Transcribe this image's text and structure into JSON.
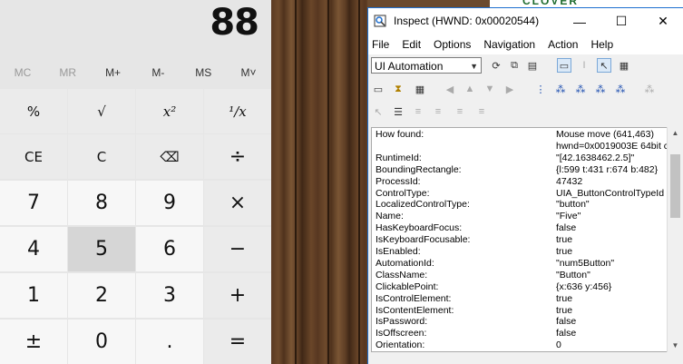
{
  "calculator": {
    "display": "88",
    "memory": [
      "MC",
      "MR",
      "M+",
      "M-",
      "MS",
      "M˅"
    ],
    "keys": [
      [
        "%",
        "√",
        "x²",
        "¹/x"
      ],
      [
        "CE",
        "C",
        "⌫",
        "÷"
      ],
      [
        "7",
        "8",
        "9",
        "×"
      ],
      [
        "4",
        "5",
        "6",
        "−"
      ],
      [
        "1",
        "2",
        "3",
        "+"
      ],
      [
        "±",
        "0",
        ".",
        "="
      ]
    ]
  },
  "background": {
    "banner_text": "CLOVER"
  },
  "inspect": {
    "title": "Inspect  (HWND: 0x00020544)",
    "window_buttons": {
      "minimize": "—",
      "maximize": "☐",
      "close": "✕"
    },
    "menu": [
      "File",
      "Edit",
      "Options",
      "Navigation",
      "Action",
      "Help"
    ],
    "mode": "UI Automation",
    "properties": [
      {
        "name": "How found:",
        "value": "Mouse move (641,463)"
      },
      {
        "name": "",
        "value": "hwnd=0x0019003E 64bit c"
      },
      {
        "name": "RuntimeId:",
        "value": "\"[42.1638462.2.5]\""
      },
      {
        "name": "BoundingRectangle:",
        "value": "{l:599 t:431 r:674 b:482}"
      },
      {
        "name": "ProcessId:",
        "value": "47432"
      },
      {
        "name": "ControlType:",
        "value": "UIA_ButtonControlTypeId"
      },
      {
        "name": "LocalizedControlType:",
        "value": "\"button\""
      },
      {
        "name": "Name:",
        "value": "\"Five\""
      },
      {
        "name": "HasKeyboardFocus:",
        "value": "false"
      },
      {
        "name": "IsKeyboardFocusable:",
        "value": "true"
      },
      {
        "name": "IsEnabled:",
        "value": "true"
      },
      {
        "name": "AutomationId:",
        "value": "\"num5Button\""
      },
      {
        "name": "ClassName:",
        "value": "\"Button\""
      },
      {
        "name": "ClickablePoint:",
        "value": "{x:636 y:456}"
      },
      {
        "name": "IsControlElement:",
        "value": "true"
      },
      {
        "name": "IsContentElement:",
        "value": "true"
      },
      {
        "name": "IsPassword:",
        "value": "false"
      },
      {
        "name": "IsOffscreen:",
        "value": "false"
      },
      {
        "name": "Orientation:",
        "value": "0"
      }
    ]
  }
}
